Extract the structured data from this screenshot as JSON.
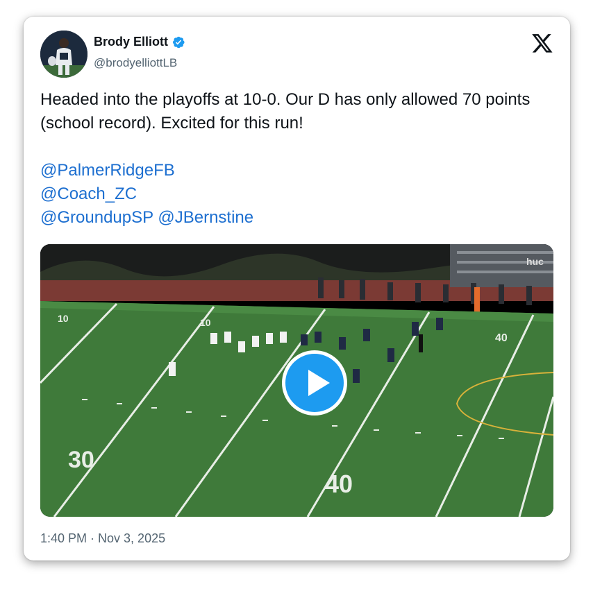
{
  "author": {
    "name": "Brody Elliott",
    "handle": "@brodyelliottLB",
    "verified": true
  },
  "tweet": {
    "text": "Headed into the playoffs at 10-0.  Our D has only allowed 70 points (school record).  Excited for this run!",
    "mentions": [
      "@PalmerRidgeFB",
      "@Coach_ZC",
      "@GroundupSP @JBernstine"
    ]
  },
  "media": {
    "type": "video",
    "yard_numbers": [
      "10",
      "10",
      "30",
      "40",
      "40"
    ],
    "watermark": "huc"
  },
  "timestamp": "1:40 PM · Nov 3, 2025",
  "colors": {
    "link": "#1d6fd0",
    "play_button": "#1d9bf0",
    "verified_badge": "#1d9bf0",
    "field_green": "#3f7a3a"
  },
  "icons": {
    "verified": "verified-badge-icon",
    "platform": "x-logo-icon",
    "play": "play-icon"
  }
}
